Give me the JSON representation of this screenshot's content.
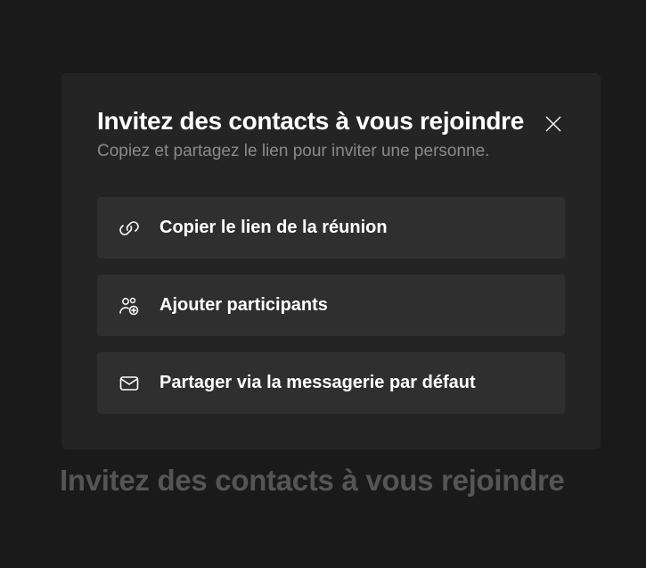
{
  "modal": {
    "title": "Invitez des contacts à vous rejoindre",
    "subtitle": "Copiez et partagez le lien pour inviter une personne.",
    "actions": {
      "copy_link": "Copier le lien de la réunion",
      "add_participants": "Ajouter participants",
      "share_email": "Partager via la messagerie par défaut"
    }
  },
  "background": {
    "title": "Invitez des contacts à vous rejoindre"
  }
}
